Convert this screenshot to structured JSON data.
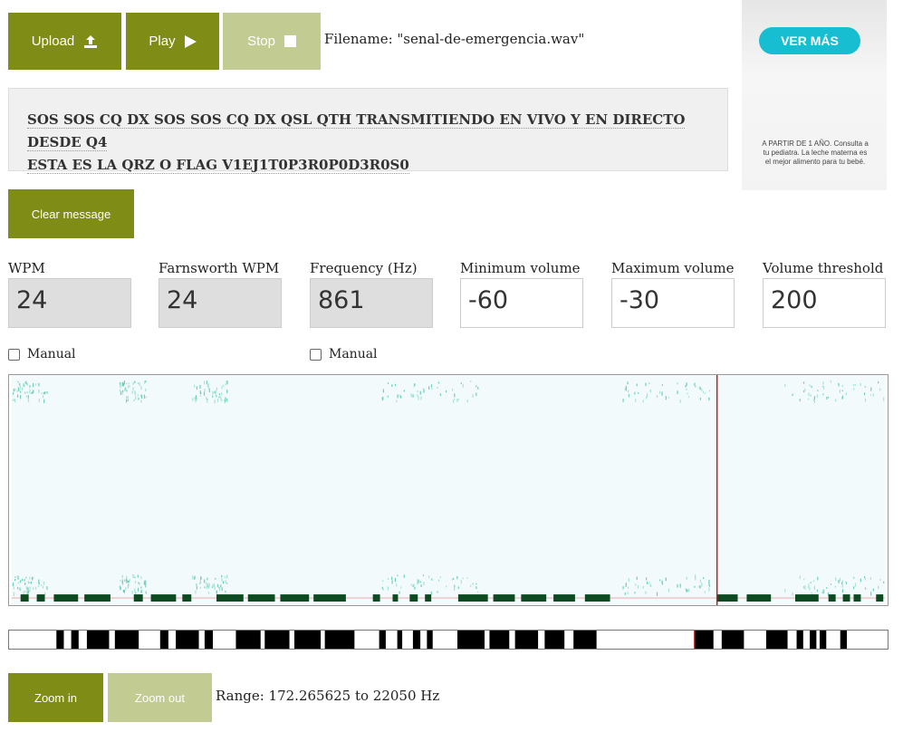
{
  "toolbar": {
    "upload_label": "Upload",
    "play_label": "Play",
    "stop_label": "Stop",
    "filename_text": "Filename: \"senal-de-emergencia.wav\""
  },
  "message": {
    "line1": "SOS SOS CQ DX SOS SOS CQ DX QSL QTH TRANSMITIENDO EN VIVO Y EN DIRECTO DESDE Q4",
    "line2": "ESTA ES LA QRZ O FLAG V1EJ1T0P3R0P0D3R0S0",
    "clear_label": "Clear message"
  },
  "ad": {
    "button_label": "VER MÁS",
    "text": "A PARTIR DE 1 AÑO. Consulta a tu pediatra. La leche materna es el mejor alimento para tu bebé."
  },
  "settings": {
    "wpm": {
      "label": "WPM",
      "value": "24"
    },
    "farnsworth": {
      "label": "Farnsworth WPM",
      "value": "24"
    },
    "frequency": {
      "label": "Frequency (Hz)",
      "value": "861"
    },
    "min_volume": {
      "label": "Minimum volume",
      "value": "-60"
    },
    "max_volume": {
      "label": "Maximum volume",
      "value": "-30"
    },
    "threshold": {
      "label": "Volume threshold",
      "value": "200"
    },
    "manual_label": "Manual"
  },
  "zoom": {
    "zoom_in_label": "Zoom in",
    "zoom_out_label": "Zoom out",
    "range_text": "Range: 172.265625 to 22050 Hz"
  },
  "colors": {
    "accent": "#7f8c16",
    "accent_disabled": "#c2cc92",
    "spectrogram_bg": "#f2fafb",
    "signal": "#0d4a22",
    "playhead": "#b22222"
  }
}
